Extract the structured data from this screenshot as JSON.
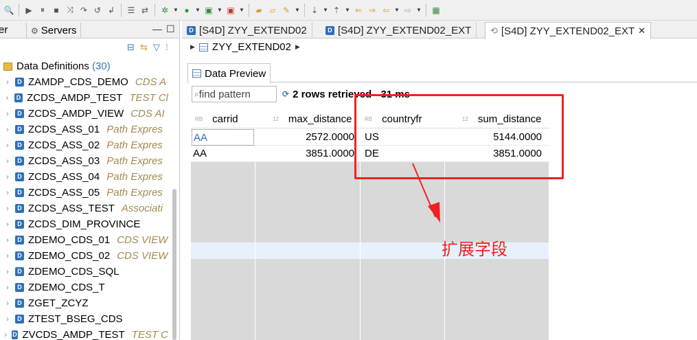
{
  "left_panel": {
    "tab_partial": "er",
    "tab_servers": "Servers",
    "tree_root": {
      "label": "Data Definitions",
      "count": "(30)"
    },
    "items": [
      {
        "name": "ZAMDP_CDS_DEMO",
        "desc": "CDS A"
      },
      {
        "name": "ZCDS_AMDP_TEST",
        "desc": "TEST Cl"
      },
      {
        "name": "ZCDS_AMDP_VIEW",
        "desc": "CDS AI"
      },
      {
        "name": "ZCDS_ASS_01",
        "desc": "Path Expres"
      },
      {
        "name": "ZCDS_ASS_02",
        "desc": "Path Expres"
      },
      {
        "name": "ZCDS_ASS_03",
        "desc": "Path Expres"
      },
      {
        "name": "ZCDS_ASS_04",
        "desc": "Path Expres"
      },
      {
        "name": "ZCDS_ASS_05",
        "desc": "Path Expres"
      },
      {
        "name": "ZCDS_ASS_TEST",
        "desc": "Associati"
      },
      {
        "name": "ZCDS_DIM_PROVINCE",
        "desc": ""
      },
      {
        "name": "ZDEMO_CDS_01",
        "desc": "CDS VIEW"
      },
      {
        "name": "ZDEMO_CDS_02",
        "desc": "CDS VIEW"
      },
      {
        "name": "ZDEMO_CDS_SQL",
        "desc": ""
      },
      {
        "name": "ZDEMO_CDS_T",
        "desc": ""
      },
      {
        "name": "ZGET_ZCYZ",
        "desc": ""
      },
      {
        "name": "ZTEST_BSEG_CDS",
        "desc": ""
      },
      {
        "name": "ZVCDS_AMDP_TEST",
        "desc": "TEST C"
      }
    ]
  },
  "editor": {
    "tabs": [
      {
        "label": "[S4D] ZYY_EXTEND02"
      },
      {
        "label": "[S4D] ZYY_EXTEND02_EXT"
      },
      {
        "label": "[S4D] ZYY_EXTEND02_EXT",
        "close": "✕"
      }
    ],
    "breadcrumb": "ZYY_EXTEND02",
    "view_tab": "Data Preview",
    "filter_placeholder": "find pattern",
    "rows_info": "2 rows retrieved - 31 ms"
  },
  "grid": {
    "columns": [
      {
        "type": "RB",
        "name": "carrid"
      },
      {
        "type": "12",
        "name": "max_distance"
      },
      {
        "type": "RB",
        "name": "countryfr"
      },
      {
        "type": "12",
        "name": "sum_distance"
      }
    ],
    "rows": [
      [
        "AA",
        "2572.0000",
        "US",
        "5144.0000"
      ],
      [
        "AA",
        "3851.0000",
        "DE",
        "3851.0000"
      ]
    ]
  },
  "annotation": {
    "label": "扩展字段",
    "color": "#ee2222"
  },
  "colors": {
    "accent": "#2f6fb8",
    "annotation": "#ee2222"
  }
}
